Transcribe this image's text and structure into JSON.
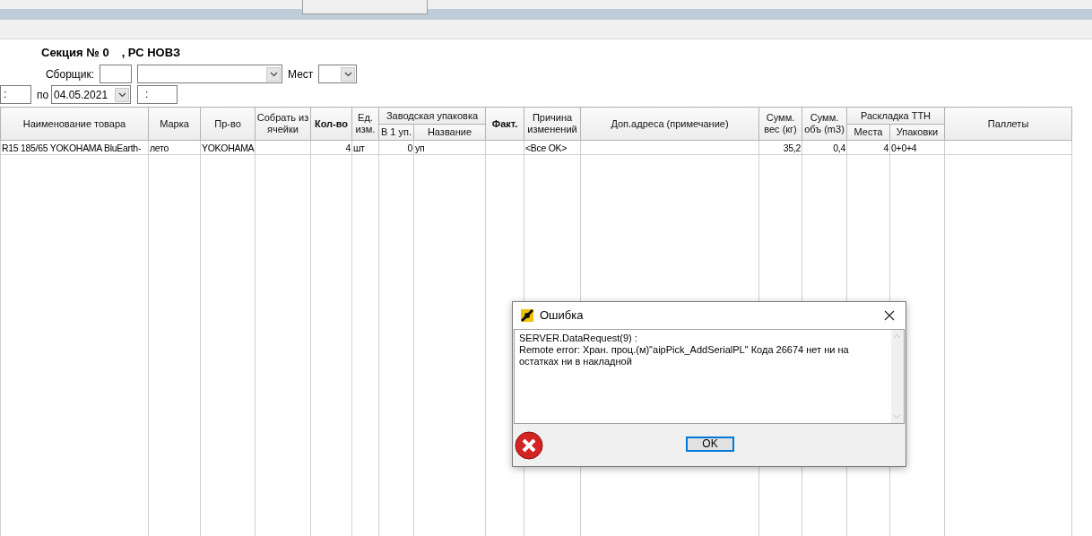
{
  "section": {
    "title": "Секция № 0",
    "suffix": ", РС НОВЗ"
  },
  "filters": {
    "picker_label": "Сборщик:",
    "places_label": "Мест",
    "date_from_value": ":",
    "date_to_label": "по",
    "date_to_value": "04.05.2021",
    "time_value": ":"
  },
  "table": {
    "column_groups": [
      {
        "label": "Заводская упаковка"
      },
      {
        "label": "Раскладка ТТН"
      }
    ],
    "columns": [
      {
        "label": "Наименование товара",
        "bold": false
      },
      {
        "label": "Марка",
        "bold": false
      },
      {
        "label": "Пр-во",
        "bold": false
      },
      {
        "label": "Собрать из ячейки",
        "bold": false
      },
      {
        "label": "Кол-во",
        "bold": true
      },
      {
        "label": "Ед. изм.",
        "bold": false
      },
      {
        "label": "В 1 уп.",
        "bold": false
      },
      {
        "label": "Название",
        "bold": false
      },
      {
        "label": "Факт.",
        "bold": true
      },
      {
        "label": "Причина изменений",
        "bold": false
      },
      {
        "label": "Доп.адреса (примечание)",
        "bold": false
      },
      {
        "label": "Сумм. вес (кг)",
        "bold": false
      },
      {
        "label": "Сумм. объ (m3)",
        "bold": false
      },
      {
        "label": "Места",
        "bold": false
      },
      {
        "label": "Упаковки",
        "bold": false
      },
      {
        "label": "Паллеты",
        "bold": false
      }
    ],
    "rows": [
      {
        "cells": [
          "R15 185/65 YOKOHAMA BluEarth-",
          "лето",
          "YOKOHAMA",
          "",
          "4",
          "шт",
          "0",
          "уп",
          "",
          "<Все OK>",
          "",
          "35,2",
          "0,4",
          "4",
          "0+0+4",
          ""
        ]
      }
    ]
  },
  "dialog": {
    "title": "Ошибка",
    "message": [
      "SERVER.DataRequest(9) :",
      "Remote error: Хран. проц.(м)\"aipPick_AddSerialPL\" Кода 26674 нет ни на остатках ни в накладной"
    ],
    "button": "OK"
  }
}
